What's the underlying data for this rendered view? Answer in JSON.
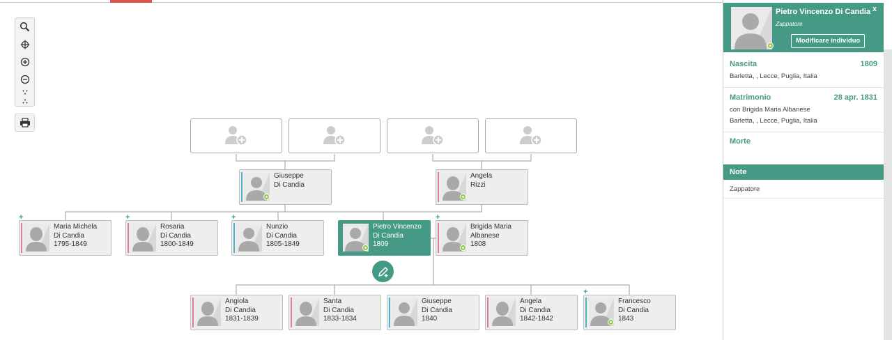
{
  "panel": {
    "name": "Pietro Vincenzo Di Candia",
    "occupation": "Zappatore",
    "edit_label": "Modificare individuo",
    "close_label": "x",
    "birth": {
      "title": "Nascita",
      "date": "1809",
      "place": "Barletta, , Lecce, Puglia, Italia"
    },
    "marriage": {
      "title": "Matrimonio",
      "date": "28 apr. 1831",
      "spouse": "con Brigida Maria Albanese",
      "place": "Barletta, , Lecce, Puglia, Italia"
    },
    "death": {
      "title": "Morte"
    },
    "note": {
      "title": "Note",
      "text": "Zappatore"
    }
  },
  "toolbar": [
    "search-icon",
    "target-icon",
    "zoom-in-icon",
    "zoom-out-icon",
    "expand-icon",
    "collapse-icon",
    "print-icon"
  ],
  "tree": {
    "parents": [
      {
        "l1": "Giuseppe",
        "l2": "Di Candia",
        "l3": ""
      },
      {
        "l1": "Angela",
        "l2": "Rizzi",
        "l3": ""
      }
    ],
    "siblings": [
      {
        "l1": "Maria Michela",
        "l2": "Di Candia",
        "l3": "1795-1849"
      },
      {
        "l1": "Rosaria",
        "l2": "Di Candia",
        "l3": "1800-1849"
      },
      {
        "l1": "Nunzio",
        "l2": "Di Candia",
        "l3": "1805-1849"
      }
    ],
    "selected": {
      "l1": "Pietro Vincenzo",
      "l2": "Di Candia",
      "l3": "1809"
    },
    "spouse": {
      "l1": "Brigida Maria",
      "l2": "Albanese",
      "l3": "1808"
    },
    "children": [
      {
        "l1": "Angiola",
        "l2": "Di Candia",
        "l3": "1831-1839"
      },
      {
        "l1": "Santa",
        "l2": "Di Candia",
        "l3": "1833-1834"
      },
      {
        "l1": "Giuseppe",
        "l2": "Di Candia",
        "l3": "1840"
      },
      {
        "l1": "Angela",
        "l2": "Di Candia",
        "l3": "1842-1842"
      },
      {
        "l1": "Francesco",
        "l2": "Di Candia",
        "l3": "1843"
      }
    ],
    "expand_marker": "+"
  },
  "colors": {
    "accent": "#459a86",
    "female": "#e07a9a",
    "male": "#4fb0c6",
    "badge": "#8cc63f"
  }
}
